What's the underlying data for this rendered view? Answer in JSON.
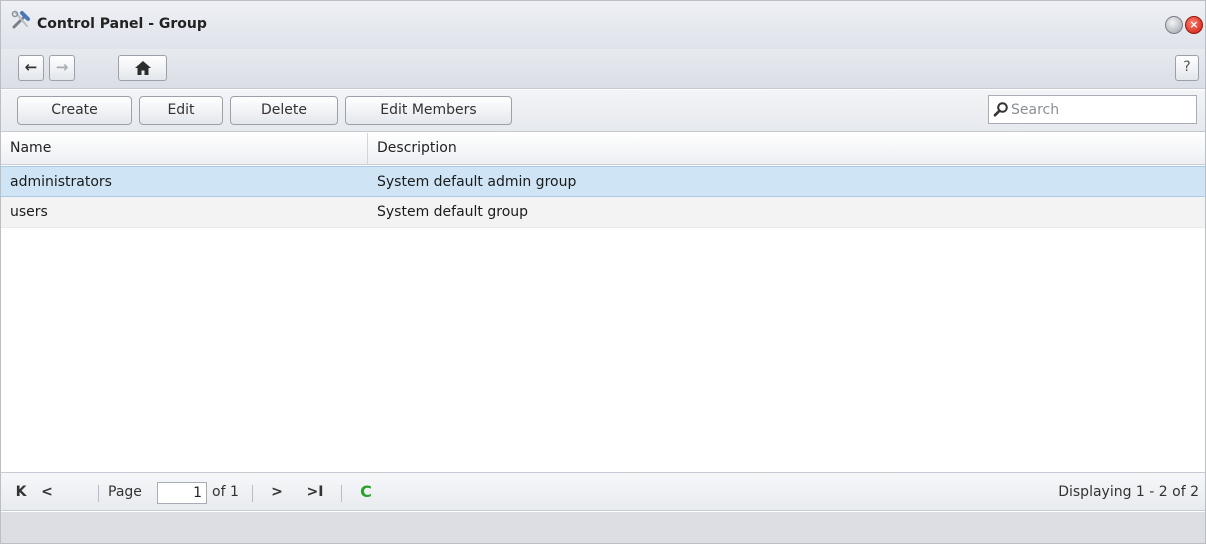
{
  "window": {
    "title": "Control Panel - Group",
    "icons": {
      "app": "tools-icon",
      "minimize": "minimize-icon",
      "close": "close-icon"
    }
  },
  "navbar": {
    "back": "←",
    "forward": "→",
    "home": "⌂",
    "help": "?"
  },
  "toolbar": {
    "create_label": "Create",
    "edit_label": "Edit",
    "delete_label": "Delete",
    "edit_members_label": "Edit Members",
    "search_placeholder": "Search"
  },
  "grid": {
    "columns": [
      "Name",
      "Description"
    ],
    "rows": [
      {
        "name": "administrators",
        "description": "System default admin group",
        "selected": true
      },
      {
        "name": "users",
        "description": "System default group",
        "selected": false
      }
    ]
  },
  "pager": {
    "first": "K",
    "prev": "<",
    "page_label": "Page",
    "page_value": "1",
    "of_label": "of 1",
    "next": ">",
    "last": ">I",
    "refresh": "C",
    "display_text": "Displaying 1 - 2 of 2"
  },
  "colors": {
    "selected_row": "#cfe5f5",
    "alt_row": "#f3f3f3",
    "refresh_green": "#2aa12a",
    "close_red": "#c81e12"
  }
}
